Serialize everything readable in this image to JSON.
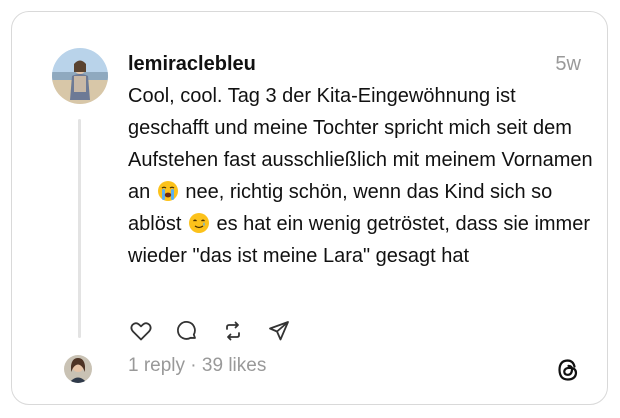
{
  "post": {
    "username": "lemiraclebleu",
    "time": "5w",
    "text_part1": "Cool, cool. Tag 3 der Kita-Eingewöhnung ist geschafft und meine Tochter spricht mich seit dem Aufstehen fast ausschließlich mit meinem Vornamen an ",
    "emoji1": "loudly-crying-face",
    "text_part2": " nee, richtig schön, wenn das Kind sich so ablöst ",
    "emoji2": "smiling-face-with-tear",
    "text_part3": " es hat ein wenig getröstet, dass sie immer wieder \"das ist meine Lara\" gesagt hat"
  },
  "actions": {
    "icons": [
      "heart-icon",
      "comment-icon",
      "repost-icon",
      "share-icon"
    ]
  },
  "stats": {
    "replies": "1 reply",
    "separator": " · ",
    "likes": "39 likes"
  },
  "colors": {
    "text": "#111111",
    "muted": "#999999",
    "border": "#d9d9d9"
  }
}
